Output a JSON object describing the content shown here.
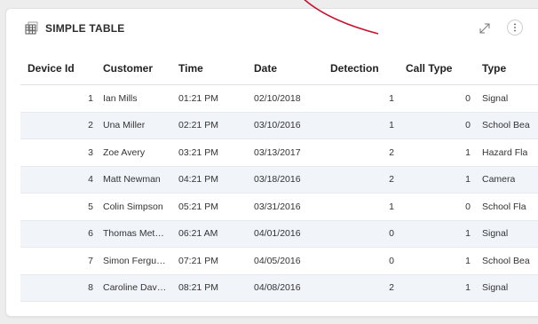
{
  "widget": {
    "title": "SIMPLE TABLE",
    "icons": {
      "title": "table-icon",
      "expand": "expand-icon",
      "more": "more-vertical-icon"
    }
  },
  "table": {
    "columns": [
      "Device Id",
      "Customer",
      "Time",
      "Date",
      "Detection",
      "Call Type",
      "Type"
    ],
    "rows": [
      {
        "device_id": "1",
        "customer": "Ian Mills",
        "time": "01:21 PM",
        "date": "02/10/2018",
        "detection": "1",
        "call_type": "0",
        "type": "Signal"
      },
      {
        "device_id": "2",
        "customer": "Una Miller",
        "time": "02:21 PM",
        "date": "03/10/2016",
        "detection": "1",
        "call_type": "0",
        "type": "School Bea"
      },
      {
        "device_id": "3",
        "customer": "Zoe Avery",
        "time": "03:21 PM",
        "date": "03/13/2017",
        "detection": "2",
        "call_type": "1",
        "type": "Hazard Fla"
      },
      {
        "device_id": "4",
        "customer": "Matt Newman",
        "time": "04:21 PM",
        "date": "03/18/2016",
        "detection": "2",
        "call_type": "1",
        "type": "Camera"
      },
      {
        "device_id": "5",
        "customer": "Colin Simpson",
        "time": "05:21 PM",
        "date": "03/31/2016",
        "detection": "1",
        "call_type": "0",
        "type": "School Fla"
      },
      {
        "device_id": "6",
        "customer": "Thomas Met…",
        "time": "06:21 AM",
        "date": "04/01/2016",
        "detection": "0",
        "call_type": "1",
        "type": "Signal"
      },
      {
        "device_id": "7",
        "customer": "Simon Fergu…",
        "time": "07:21 PM",
        "date": "04/05/2016",
        "detection": "0",
        "call_type": "1",
        "type": "School Bea"
      },
      {
        "device_id": "8",
        "customer": "Caroline Dav…",
        "time": "08:21 PM",
        "date": "04/08/2016",
        "detection": "2",
        "call_type": "1",
        "type": "Signal"
      }
    ]
  },
  "colors": {
    "row_alt": "#f1f5fa",
    "annotation_stroke": "#c8102e"
  }
}
